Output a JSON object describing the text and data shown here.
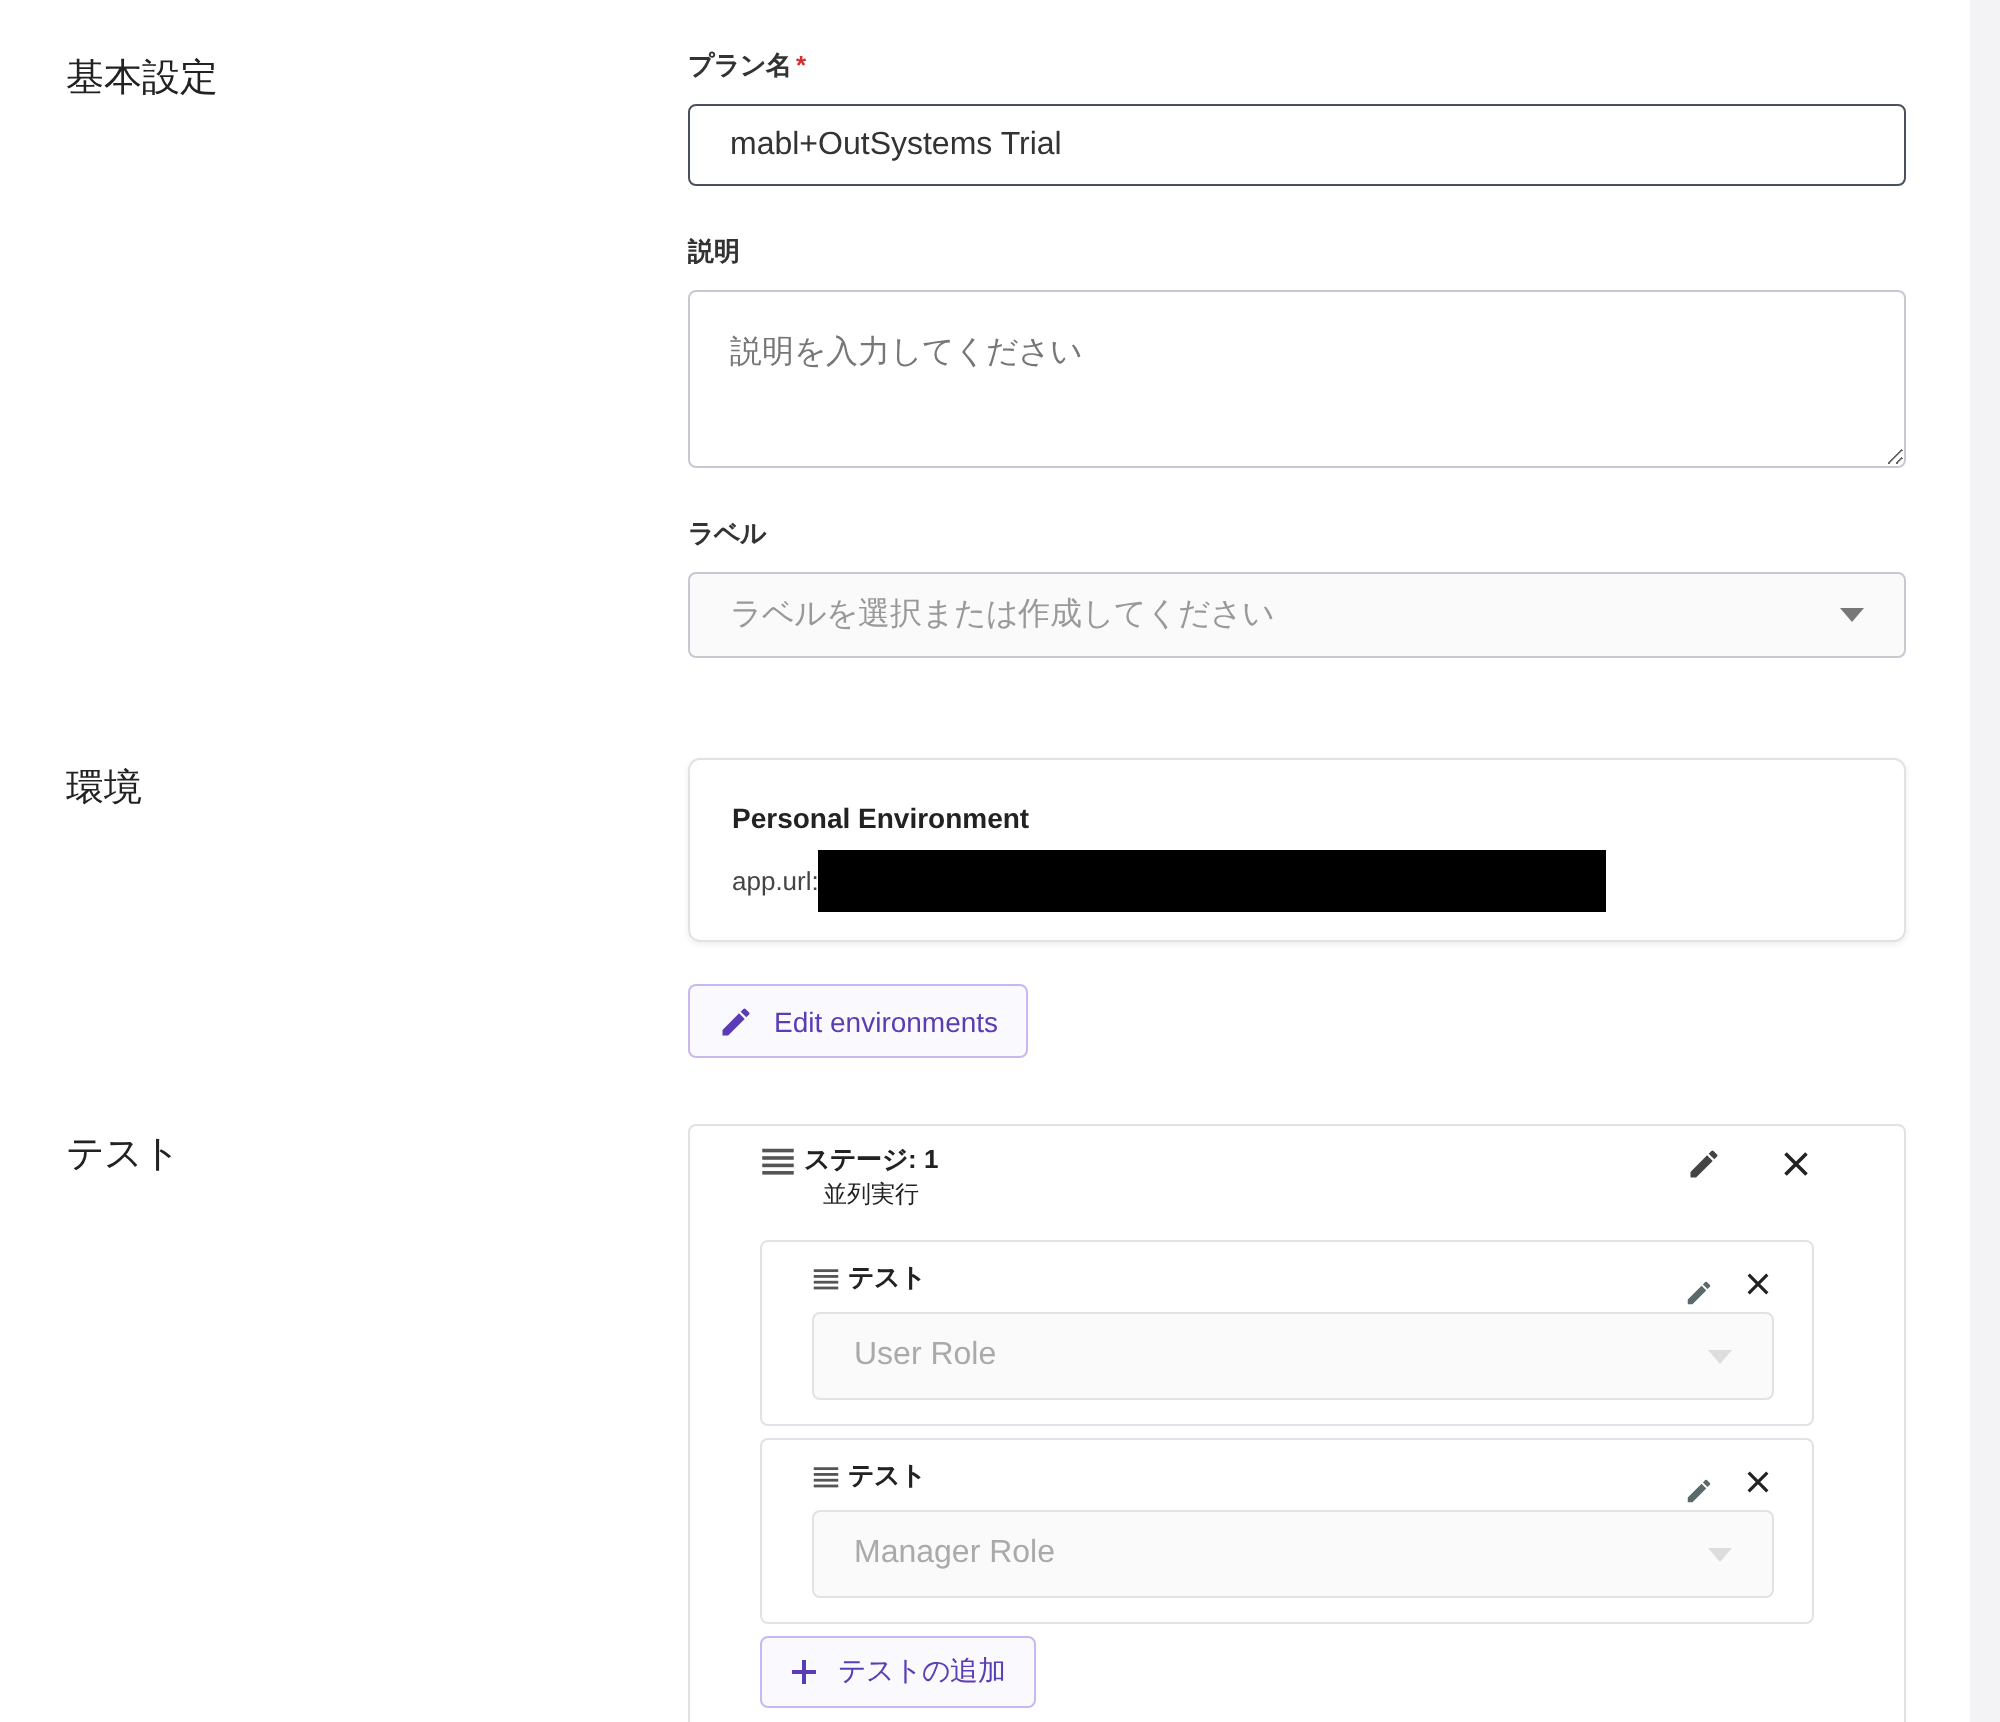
{
  "sections": [
    {
      "kind": "basic",
      "title": "基本設定",
      "plan_name": {
        "label": "プラン名",
        "required_mark": "*",
        "value": "mabl+OutSystems Trial"
      },
      "description": {
        "label": "説明",
        "placeholder": "説明を入力してください"
      },
      "labels": {
        "label": "ラベル",
        "placeholder": "ラベルを選択または作成してください"
      }
    },
    {
      "kind": "environment",
      "title": "環境",
      "environment": {
        "name": "Personal Environment",
        "url_label": "app.url:"
      },
      "edit_button": "Edit environments"
    },
    {
      "kind": "tests",
      "title": "テスト",
      "stage": {
        "title": "ステージ: 1",
        "mode": "並列実行",
        "tests": [
          {
            "label": "テスト",
            "value": "User Role",
            "disabled": true
          },
          {
            "label": "テスト",
            "value": "Manager Role",
            "disabled": true
          }
        ],
        "add_button": "テストの追加"
      }
    }
  ]
}
